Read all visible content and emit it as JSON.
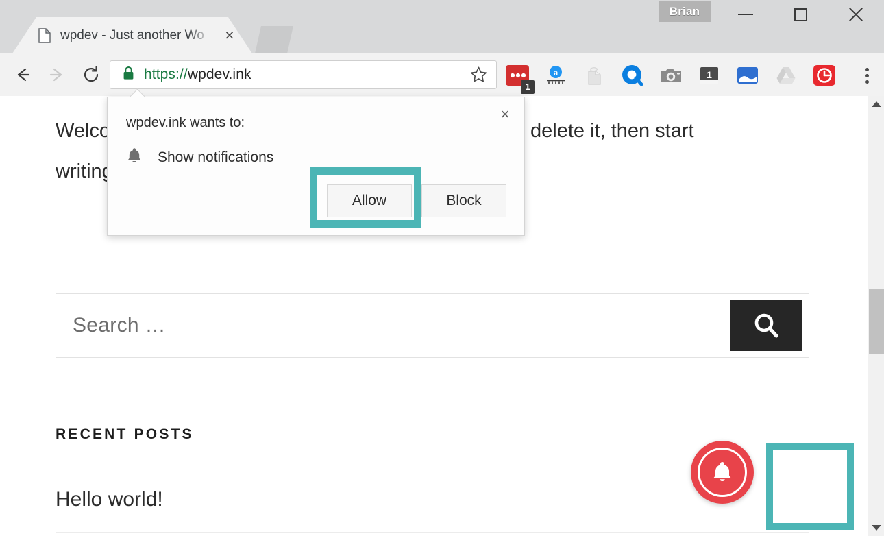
{
  "window": {
    "profile_name": "Brian",
    "controls": [
      {
        "name": "minimize",
        "label": "Minimize"
      },
      {
        "name": "maximize",
        "label": "Maximize"
      },
      {
        "name": "close",
        "label": "Close"
      }
    ]
  },
  "tab": {
    "title": "wpdev - Just another Wo",
    "close_label": "×",
    "favicon": "page-icon",
    "new_tab_label": "New tab"
  },
  "toolbar": {
    "back_label": "Back",
    "forward_label": "Forward",
    "reload_label": "Reload",
    "bookmark_label": "Bookmark this page",
    "menu_label": "Customize and control Google Chrome",
    "url": {
      "scheme": "https://",
      "host": "wpdev.ink",
      "full": "https://wpdev.ink",
      "secure": true,
      "lock_color": "#1a7a42"
    },
    "extensions": [
      {
        "name": "lastpass-extension",
        "badge": "1"
      },
      {
        "name": "amazon-assistant-extension",
        "badge": ""
      },
      {
        "name": "evernote-webclipper-extension",
        "badge": ""
      },
      {
        "name": "hunter-extension",
        "badge": ""
      },
      {
        "name": "screenshot-camera-extension",
        "badge": ""
      },
      {
        "name": "calendar-extension",
        "badge": "1"
      },
      {
        "name": "bluescreen-extension",
        "badge": ""
      },
      {
        "name": "google-drive-extension",
        "badge": ""
      },
      {
        "name": "grammarly-extension",
        "badge": ""
      }
    ]
  },
  "permission_dialog": {
    "title": "wpdev.ink wants to:",
    "request_icon": "bell-icon",
    "request_label": "Show notifications",
    "allow_label": "Allow",
    "block_label": "Block",
    "close_label": "×",
    "highlight_color": "#4cb5b5",
    "highlighted_button": "Allow"
  },
  "page": {
    "post_excerpt_line1": "Welcome to WordPress. This is your first post. Edit or delete it, then start",
    "post_excerpt_line2": "writing!",
    "search": {
      "placeholder": "Search …",
      "value": "",
      "submit_icon": "search-icon",
      "submit_color": "#262626"
    },
    "recent_posts": {
      "heading": "RECENT POSTS",
      "items": [
        {
          "title": "Hello world!"
        }
      ]
    },
    "notification_widget": {
      "icon": "bell-icon",
      "color": "#e8434a",
      "highlight_color": "#4cb5b5"
    }
  },
  "scrollbar": {
    "up_label": "Scroll up",
    "down_label": "Scroll down",
    "thumb_label": "Scroll thumb"
  }
}
